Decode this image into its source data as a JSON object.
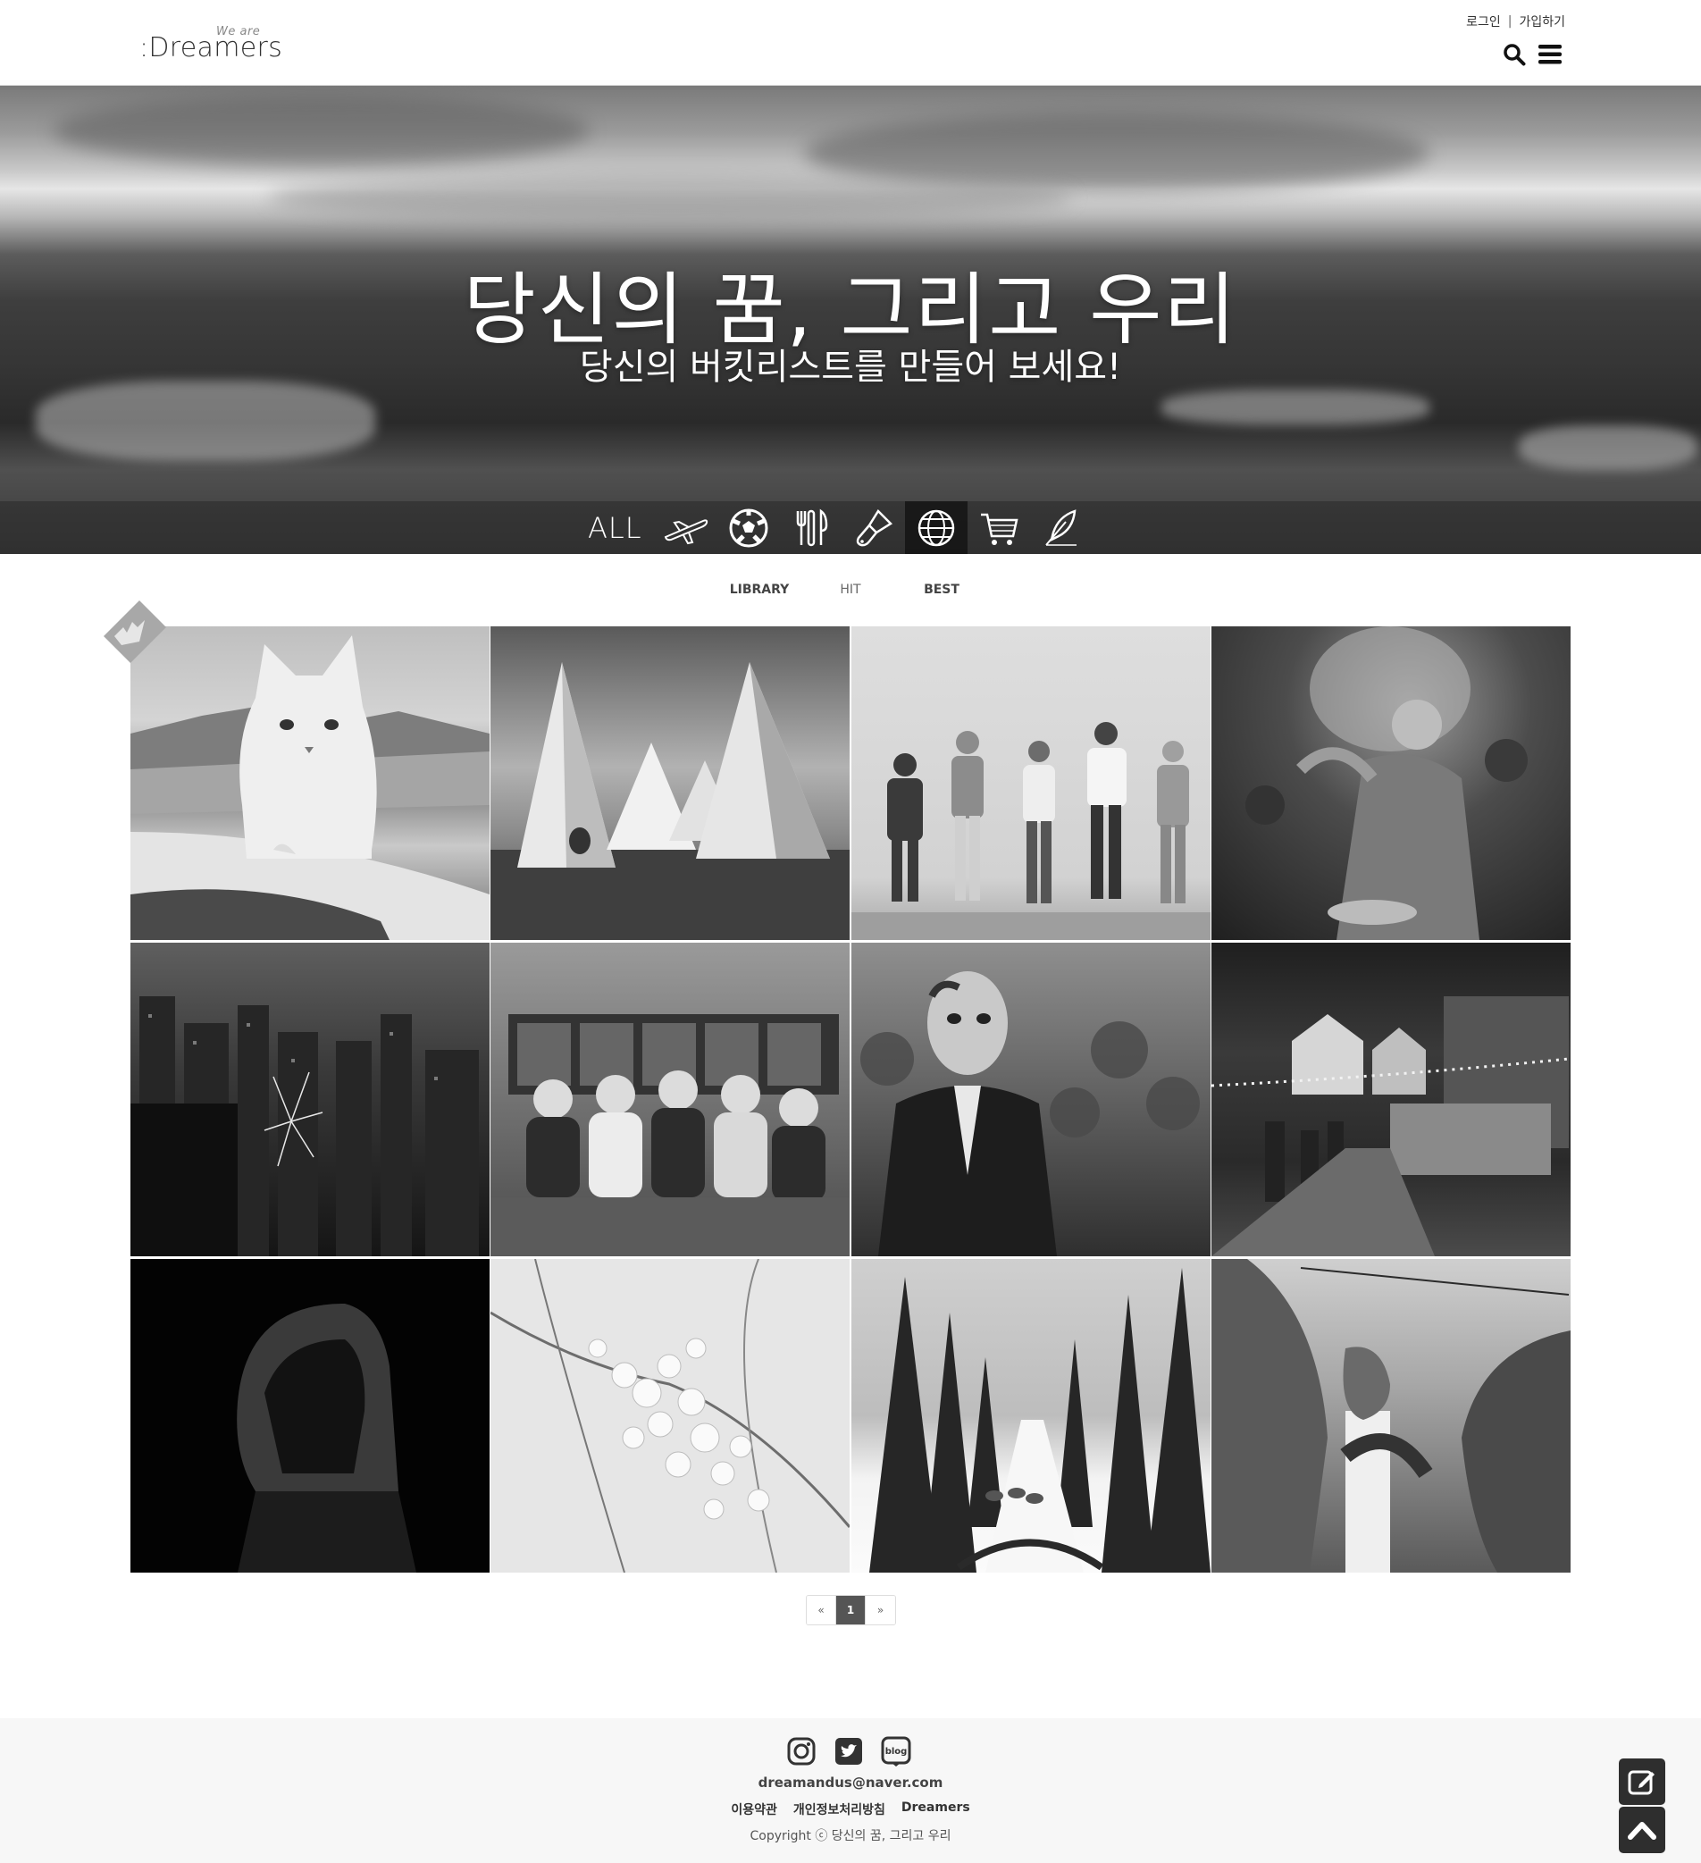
{
  "header": {
    "logo_main": ":Dreamers",
    "logo_small": "We are",
    "login": "로그인",
    "separator": "|",
    "signup": "가입하기"
  },
  "hero": {
    "title": "당신의 꿈, 그리고 우리",
    "subtitle": "당신의 버킷리스트를 만들어 보세요!",
    "categories": [
      {
        "label": "ALL"
      },
      {
        "icon": "airplane-icon"
      },
      {
        "icon": "soccer-ball-icon"
      },
      {
        "icon": "fork-knife-icon"
      },
      {
        "icon": "paintbrush-icon"
      },
      {
        "icon": "globe-icon",
        "active": true
      },
      {
        "icon": "shopping-cart-icon"
      },
      {
        "icon": "feather-pen-icon"
      }
    ]
  },
  "tabs": [
    "LIBRARY",
    "HIT",
    "BEST"
  ],
  "gallery": [
    {
      "subject": "cat-photo"
    },
    {
      "subject": "teepees-photo"
    },
    {
      "subject": "group-people-photo"
    },
    {
      "subject": "holi-festival-photo"
    },
    {
      "subject": "city-fireworks-photo"
    },
    {
      "subject": "party-friends-photo"
    },
    {
      "subject": "zombie-photo"
    },
    {
      "subject": "night-market-photo"
    },
    {
      "subject": "hooded-figure-photo"
    },
    {
      "subject": "cherry-blossom-photo"
    },
    {
      "subject": "dog-sled-photo"
    },
    {
      "subject": "wrestlers-photo"
    }
  ],
  "pagination": {
    "prev": "«",
    "current": "1",
    "next": "»"
  },
  "footer": {
    "email": "dreamandus@naver.com",
    "links": [
      "이용약관",
      "개인정보처리방침",
      "Dreamers"
    ],
    "copyright": "Copyright ⓒ 당신의 꿈, 그리고 우리",
    "blog_label": "blog"
  }
}
